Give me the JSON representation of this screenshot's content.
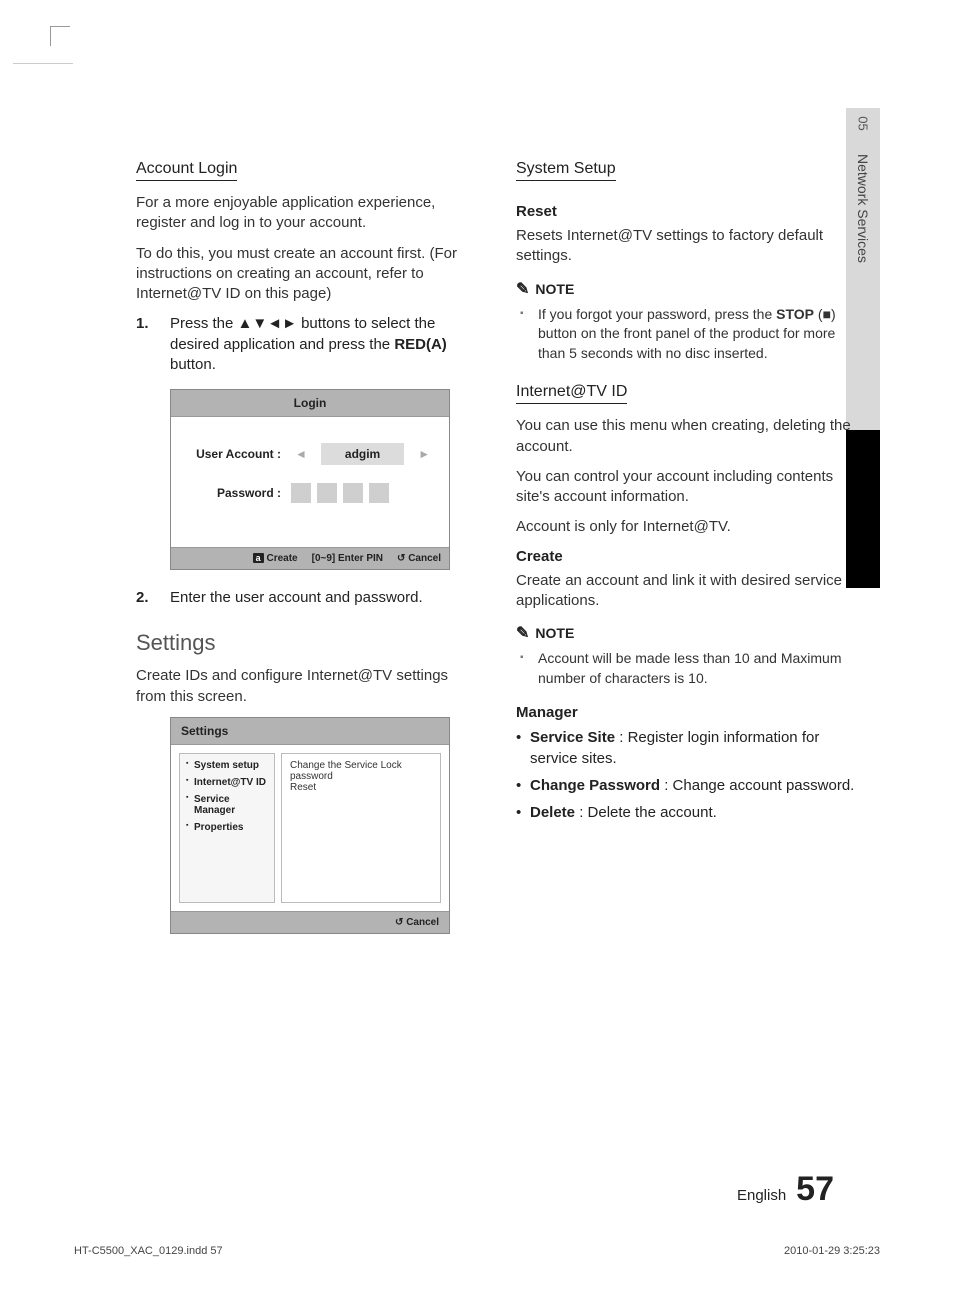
{
  "sideTab": {
    "num": "05",
    "label": "Network Services"
  },
  "left": {
    "h_account_login": "Account Login",
    "p1": "For a more enjoyable application experience, register and log in to your account.",
    "p2": "To do this, you must create an account first. (For instructions on creating an account, refer to Internet@TV ID on this page)",
    "step1_pre": "Press the ",
    "step1_arrows": "▲▼◄►",
    "step1_mid": " buttons to select the desired application and press the ",
    "step1_red": "RED(A)",
    "step1_post": " button.",
    "login_ui": {
      "title": "Login",
      "user_label": "User Account :",
      "user_value": "adgim",
      "pass_label": "Password :",
      "foot_create": "Create",
      "foot_enter": "[0~9] Enter PIN",
      "foot_cancel": "Cancel"
    },
    "step2": "Enter the user account and password.",
    "h_settings": "Settings",
    "p_settings": "Create IDs and configure Internet@TV settings from this screen.",
    "settings_ui": {
      "title": "Settings",
      "side": [
        "System setup",
        "Internet@TV ID",
        "Service Manager",
        "Properties"
      ],
      "main1": "Change the Service Lock password",
      "main2": "Reset",
      "foot_cancel": "Cancel"
    }
  },
  "right": {
    "h_system_setup": "System Setup",
    "h_reset": "Reset",
    "p_reset": "Resets Internet@TV settings to factory default settings.",
    "note_label": "NOTE",
    "note1_pre": "If you forgot your password, press the ",
    "note1_stop": "STOP",
    "note1_mid": " (",
    "note1_sq": "■",
    "note1_post": ") button on the front panel of the product for more than 5 seconds with no disc inserted.",
    "h_itv": "Internet@TV ID",
    "p_itv1": "You can use this menu when creating, deleting the account.",
    "p_itv2": "You can control your account including contents site's account information.",
    "p_itv3": "Account is only for Internet@TV.",
    "h_create": "Create",
    "p_create": "Create an account and link it with desired service applications.",
    "note2": "Account will be made less than 10 and Maximum number of characters is 10.",
    "h_manager": "Manager",
    "mgr": [
      {
        "b": "Service Site",
        "t": " : Register login information for service sites."
      },
      {
        "b": "Change Password",
        "t": " : Change account password."
      },
      {
        "b": "Delete",
        "t": " : Delete the account."
      }
    ]
  },
  "footer": {
    "lang": "English",
    "page": "57",
    "imprint_left": "HT-C5500_XAC_0129.indd   57",
    "imprint_right": "2010-01-29   3:25:23"
  }
}
